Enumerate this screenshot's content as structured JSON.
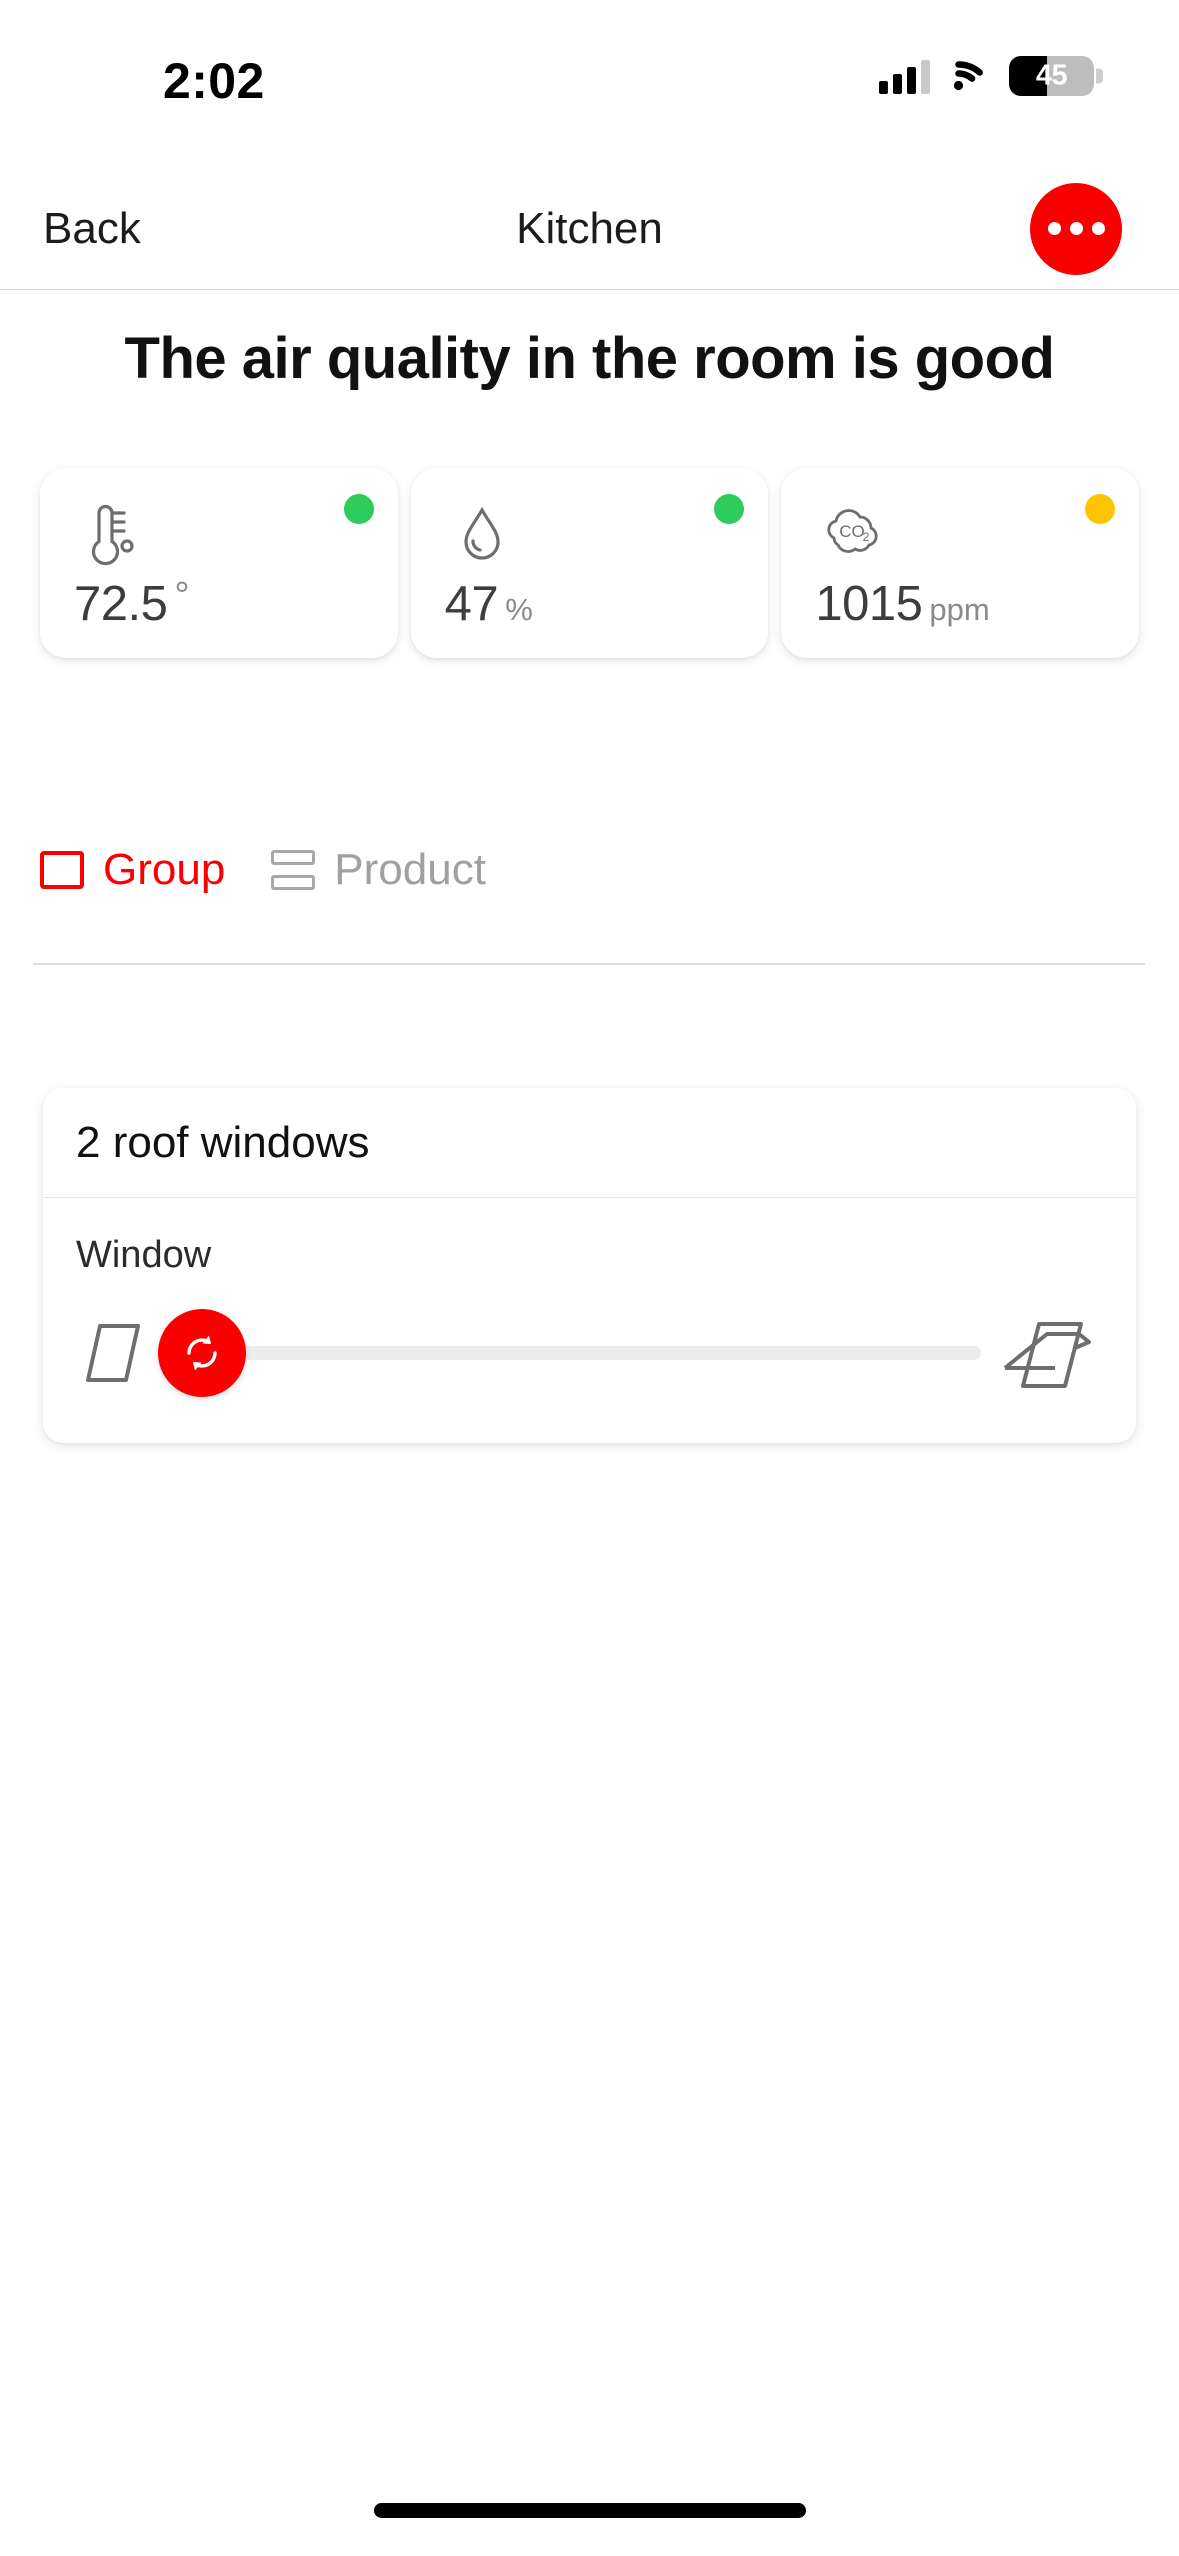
{
  "status_bar": {
    "time": "2:02",
    "signal_icon": "cellular-signal-icon",
    "signal_bars_filled": 3,
    "signal_bars_total": 4,
    "wifi_icon": "wifi-icon",
    "battery_percent_label": "45",
    "battery_level": 45,
    "battery_icon": "battery-icon"
  },
  "nav": {
    "back_label": "Back",
    "title": "Kitchen",
    "more_icon": "more-options-icon",
    "more_accent": "#FA0000"
  },
  "headline": "The air quality in the room is good",
  "sensors": [
    {
      "icon": "thermometer-icon",
      "value": "72.5",
      "unit": "°",
      "status": "good",
      "status_color": "#2ECC5B"
    },
    {
      "icon": "humidity-droplet-icon",
      "value": "47",
      "unit": "%",
      "status": "good",
      "status_color": "#2ECC5B"
    },
    {
      "icon": "co2-cloud-icon",
      "value": "1015",
      "unit": "ppm",
      "status": "warning",
      "status_color": "#FFC400"
    }
  ],
  "tabs": [
    {
      "label": "Group",
      "icon": "group-square-icon",
      "active": true,
      "color": "#FA0000"
    },
    {
      "label": "Product",
      "icon": "product-stack-icon",
      "active": false,
      "color": "#A0A0A0"
    }
  ],
  "group_card": {
    "title": "2 roof windows",
    "control": {
      "label": "Window",
      "closed_icon": "window-closed-icon",
      "open_icon": "window-open-icon",
      "thumb_icon": "sync-refresh-icon",
      "thumb_color": "#FA0000",
      "slider_value": 0,
      "slider_min": 0,
      "slider_max": 100
    }
  },
  "home_indicator": "home-indicator"
}
